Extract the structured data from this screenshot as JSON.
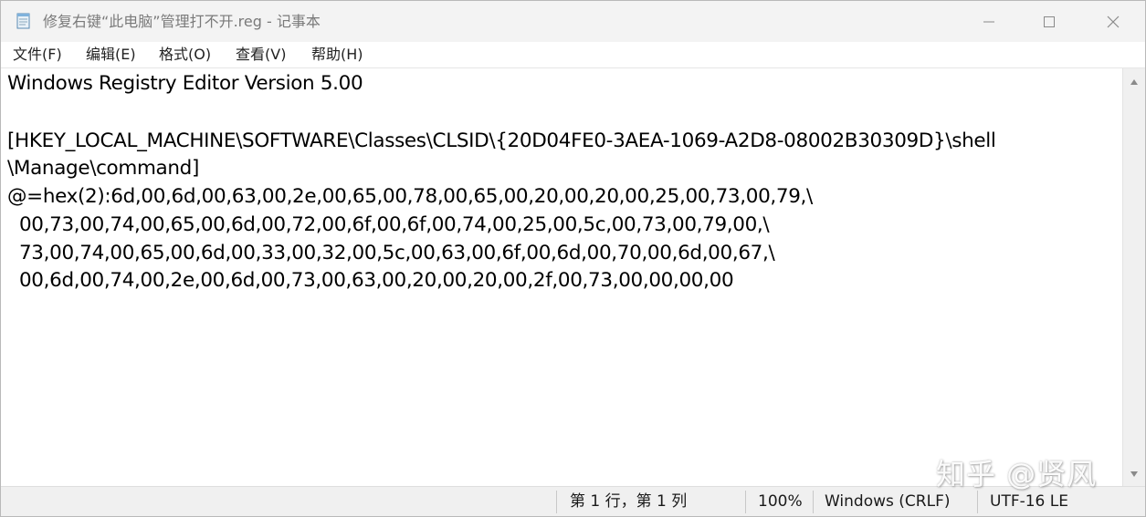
{
  "window": {
    "title": "修复右键“此电脑”管理打不开.reg - 记事本",
    "icon": "notepad-icon"
  },
  "menu": {
    "items": [
      "文件(F)",
      "编辑(E)",
      "格式(O)",
      "查看(V)",
      "帮助(H)"
    ]
  },
  "editor": {
    "lines": [
      "Windows Registry Editor Version 5.00",
      "",
      "[HKEY_LOCAL_MACHINE\\SOFTWARE\\Classes\\CLSID\\{20D04FE0-3AEA-1069-A2D8-08002B30309D}\\shell",
      "\\Manage\\command]",
      "@=hex(2):6d,00,6d,00,63,00,2e,00,65,00,78,00,65,00,20,00,20,00,25,00,73,00,79,\\",
      "  00,73,00,74,00,65,00,6d,00,72,00,6f,00,6f,00,74,00,25,00,5c,00,73,00,79,00,\\",
      "  73,00,74,00,65,00,6d,00,33,00,32,00,5c,00,63,00,6f,00,6d,00,70,00,6d,00,67,\\",
      "  00,6d,00,74,00,2e,00,6d,00,73,00,63,00,20,00,20,00,2f,00,73,00,00,00,00"
    ]
  },
  "status": {
    "position": "第 1 行，第 1 列",
    "zoom": "100%",
    "line_ending": "Windows (CRLF)",
    "encoding": "UTF-16 LE"
  },
  "watermark": "知乎 @贤风"
}
